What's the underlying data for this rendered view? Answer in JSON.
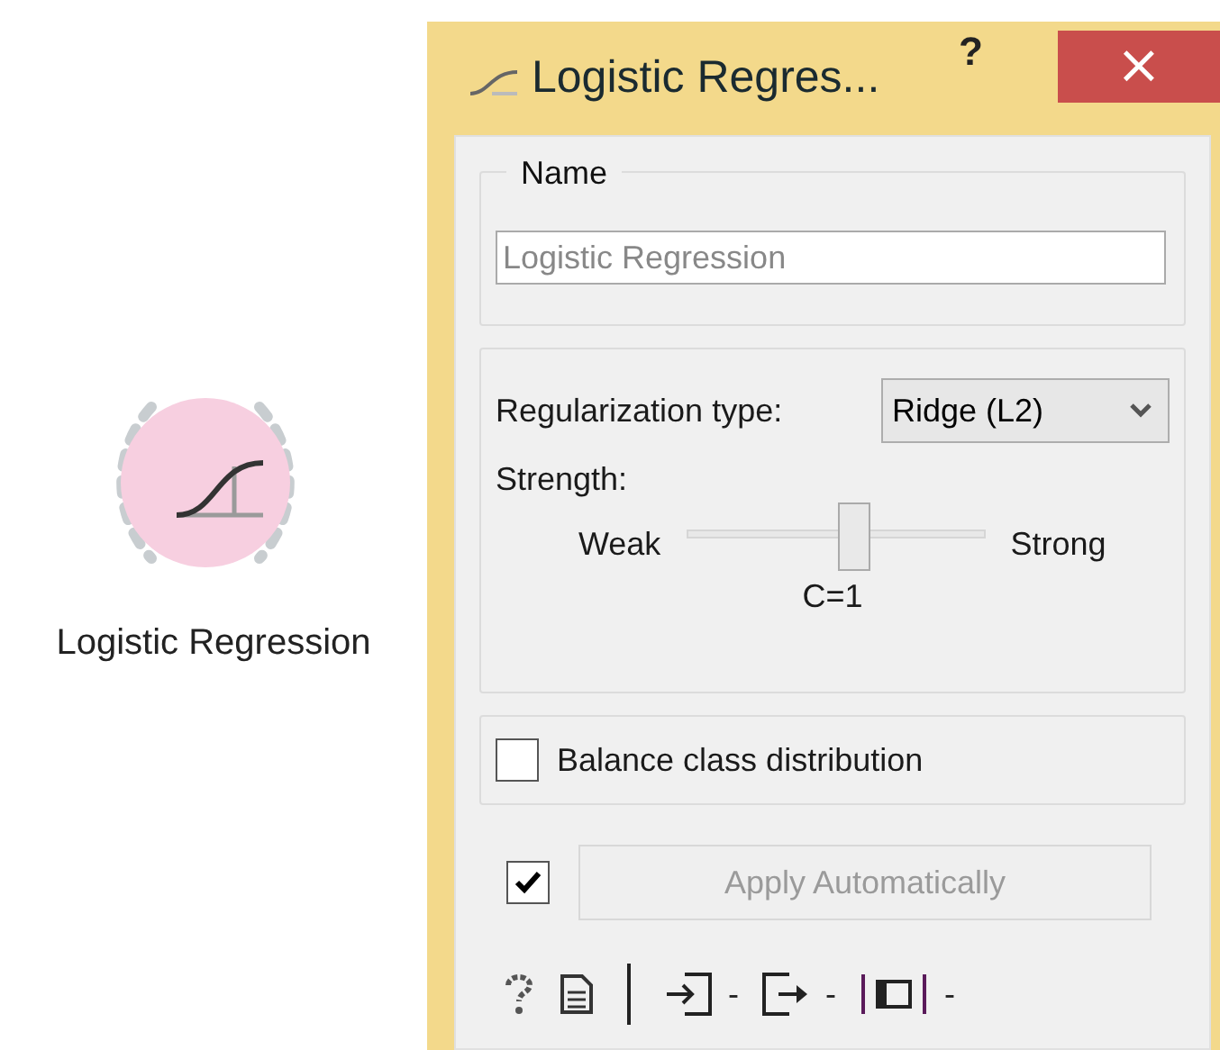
{
  "canvas": {
    "node": {
      "label": "Logistic Regression"
    }
  },
  "window": {
    "title": "Logistic Regres...",
    "help": "?",
    "close": "×"
  },
  "name_box": {
    "title": "Name",
    "placeholder": "Logistic Regression"
  },
  "regularization": {
    "label": "Regularization type:",
    "value": "Ridge (L2)",
    "strength_label": "Strength:",
    "min_label": "Weak",
    "max_label": "Strong",
    "level": 0.56,
    "reading": "C=1"
  },
  "balance": {
    "label": "Balance class distribution",
    "checked": false
  },
  "apply": {
    "checked": true,
    "label": "Apply Automatically",
    "disabled": true
  },
  "status_bar": {
    "input_count": "-",
    "output_count": "-",
    "frame_count": "-"
  }
}
